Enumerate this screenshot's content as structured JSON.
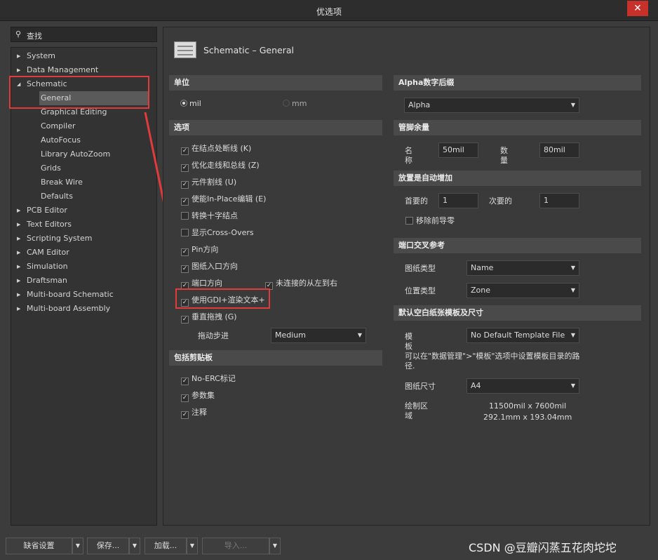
{
  "window": {
    "title": "优选项",
    "close": "✕"
  },
  "search": {
    "placeholder": "查找"
  },
  "tree": [
    {
      "label": "System",
      "expanded": false
    },
    {
      "label": "Data Management",
      "expanded": false
    },
    {
      "label": "Schematic",
      "expanded": true
    },
    {
      "label": "General",
      "selected": true
    },
    {
      "label": "Graphical Editing"
    },
    {
      "label": "Compiler"
    },
    {
      "label": "AutoFocus"
    },
    {
      "label": "Library AutoZoom"
    },
    {
      "label": "Grids"
    },
    {
      "label": "Break Wire"
    },
    {
      "label": "Defaults"
    },
    {
      "label": "PCB Editor",
      "expanded": false
    },
    {
      "label": "Text Editors",
      "expanded": false
    },
    {
      "label": "Scripting System",
      "expanded": false
    },
    {
      "label": "CAM Editor",
      "expanded": false
    },
    {
      "label": "Simulation",
      "expanded": false
    },
    {
      "label": "Draftsman",
      "expanded": false
    },
    {
      "label": "Multi-board Schematic",
      "expanded": false
    },
    {
      "label": "Multi-board Assembly",
      "expanded": false
    }
  ],
  "page_title": "Schematic – General",
  "units": {
    "header": "单位",
    "mil": "mil",
    "mm": "mm"
  },
  "options": {
    "header": "选项",
    "items": [
      "在结点处断线 (K)",
      "优化走线和总线 (Z)",
      "元件割线 (U)",
      "使能In-Place编辑 (E)",
      "转换十字结点",
      "显示Cross-Overs",
      "Pin方向",
      "图纸入口方向",
      "端口方向",
      "使用GDI+渲染文本+",
      "垂直拖拽 (G)"
    ],
    "unconnected": "未连接的从左到右",
    "drag_step_label": "拖动步进",
    "drag_step_value": "Medium"
  },
  "clipboard": {
    "header": "包括剪贴板",
    "items": [
      "No-ERC标记",
      "参数集",
      "注释"
    ]
  },
  "alpha": {
    "header": "Alpha数字后缀",
    "value": "Alpha"
  },
  "pin_margin": {
    "header": "管脚余量",
    "name_label": "名\n称",
    "name_value": "50mil",
    "number_label": "数\n量",
    "number_value": "80mil"
  },
  "auto_increment": {
    "header": "放置是自动增加",
    "primary_label": "首要的",
    "primary_value": "1",
    "secondary_label": "次要的",
    "secondary_value": "1",
    "remove_leading_zero": "移除前导零"
  },
  "port_cross": {
    "header": "端口交叉参考",
    "sheet_type_label": "图纸类型",
    "sheet_type_value": "Name",
    "location_type_label": "位置类型",
    "location_type_value": "Zone"
  },
  "template": {
    "header": "默认空白纸张模板及尺寸",
    "template_label": "模\n板",
    "template_value": "No Default Template File",
    "hint": "可以在\"数据管理\">\"模板\"选项中设置模板目录的路\n径.",
    "size_label": "图纸尺寸",
    "size_value": "A4",
    "area_label": "绘制区\n域",
    "area_mil": "11500mil x 7600mil",
    "area_mm": "292.1mm x 193.04mm"
  },
  "footer": {
    "defaults": "缺省设置",
    "save": "保存...",
    "load": "加载...",
    "import": "导入...",
    "watermark": "CSDN @豆瓣闪蒸五花肉坨坨"
  }
}
